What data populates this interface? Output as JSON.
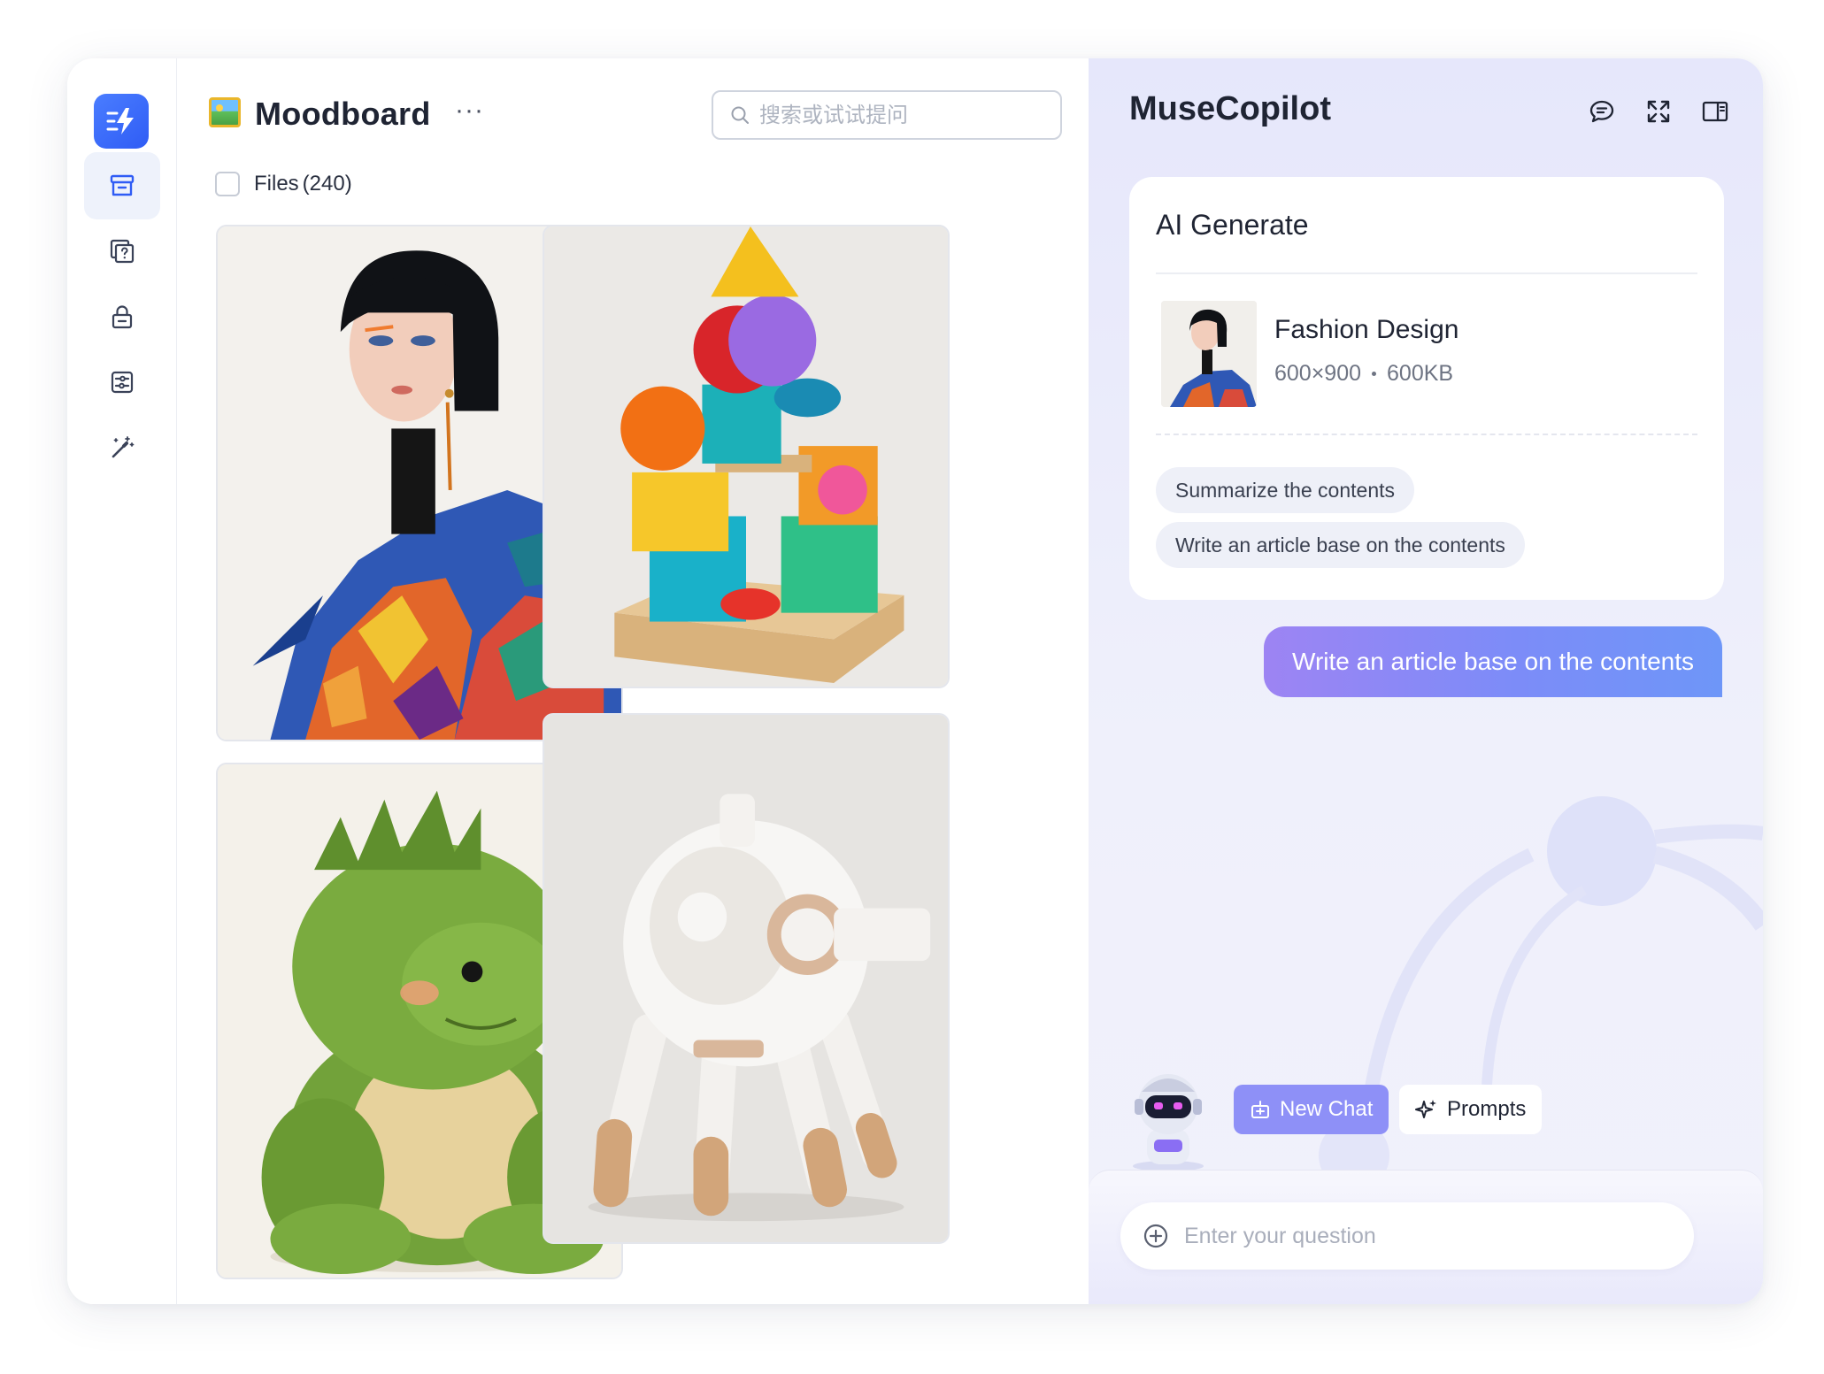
{
  "sidebar": {
    "logo_icon": "lightning-icon",
    "items": [
      {
        "name": "archive",
        "icon": "archive-icon",
        "active": true
      },
      {
        "name": "help",
        "icon": "help-icon",
        "active": false
      },
      {
        "name": "lock",
        "icon": "lock-icon",
        "active": false
      },
      {
        "name": "settings",
        "icon": "sliders-icon",
        "active": false
      },
      {
        "name": "magic",
        "icon": "magic-wand-icon",
        "active": false
      }
    ]
  },
  "board": {
    "title": "Moodboard",
    "more": "···",
    "search_placeholder": "搜索或试试提问",
    "files_label": "Files",
    "files_count": "(240)",
    "images": [
      {
        "subject": "fashion-portrait"
      },
      {
        "subject": "wooden-blocks"
      },
      {
        "subject": "plush-dinosaur"
      },
      {
        "subject": "robot-device"
      }
    ]
  },
  "copilot": {
    "title": "MuseCopilot",
    "icons": [
      "chat-icon",
      "expand-icon",
      "panel-icon"
    ],
    "card": {
      "title": "AI Generate",
      "file_name": "Fashion Design",
      "file_dims": "600×900",
      "file_size": "600KB",
      "suggestions": [
        "Summarize the contents",
        "Write an article base on the contents"
      ]
    },
    "user_message": "Write an article base on the contents",
    "new_chat_label": "New Chat",
    "prompts_label": "Prompts",
    "input_placeholder": "Enter your question"
  },
  "colors": {
    "accent": "#2f5cf5",
    "new_chat": "#8e90f7",
    "message_gradient_start": "#9d84f3",
    "message_gradient_end": "#6e96f8"
  }
}
